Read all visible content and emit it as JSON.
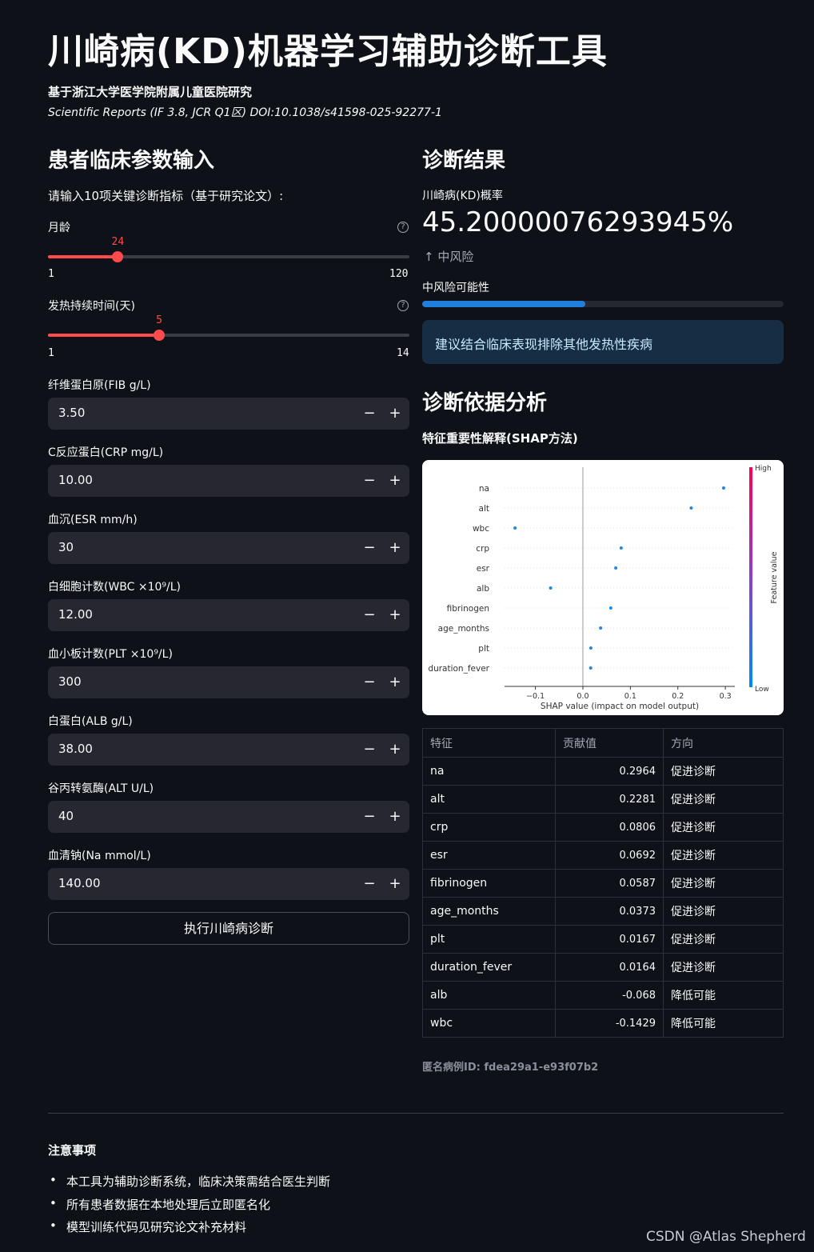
{
  "header": {
    "title": "川崎病(KD)机器学习辅助诊断工具",
    "subtitle": "基于浙江大学医学院附属儿童医院研究",
    "citation": "Scientific Reports (IF 3.8, JCR Q1区) DOI:10.1038/s41598-025-92277-1"
  },
  "input_section": {
    "heading": "患者临床参数输入",
    "instruction": "请输入10项关键诊断指标（基于研究论文）:",
    "sliders": [
      {
        "label": "月龄",
        "value": "24",
        "min": "1",
        "max": "120",
        "fraction": 0.1933
      },
      {
        "label": "发热持续时间(天)",
        "value": "5",
        "min": "1",
        "max": "14",
        "fraction": 0.3077
      }
    ],
    "number_inputs": [
      {
        "label": "纤维蛋白原(FIB g/L)",
        "value": "3.50"
      },
      {
        "label": "C反应蛋白(CRP mg/L)",
        "value": "10.00"
      },
      {
        "label": "血沉(ESR mm/h)",
        "value": "30"
      },
      {
        "label": "白细胞计数(WBC ×10⁹/L)",
        "value": "12.00"
      },
      {
        "label": "血小板计数(PLT ×10⁹/L)",
        "value": "300"
      },
      {
        "label": "白蛋白(ALB g/L)",
        "value": "38.00"
      },
      {
        "label": "谷丙转氨酶(ALT U/L)",
        "value": "40"
      },
      {
        "label": "血清钠(Na mmol/L)",
        "value": "140.00"
      }
    ],
    "minus_glyph": "−",
    "plus_glyph": "+",
    "help_glyph": "?",
    "submit_label": "执行川崎病诊断"
  },
  "result_section": {
    "heading": "诊断结果",
    "metric_label": "川崎病(KD)概率",
    "metric_value": "45.20000076293945%",
    "delta_arrow": "↑",
    "delta_text": "中风险",
    "progress_label": "中风险可能性",
    "progress_fraction": 0.452,
    "info_text": "建议结合临床表现排除其他发热性疾病",
    "progress_color": "#1f7fdb"
  },
  "analysis_section": {
    "heading": "诊断依据分析",
    "subheading": "特征重要性解释(SHAP方法)"
  },
  "chart_data": {
    "type": "scatter",
    "categories": [
      "na",
      "alt",
      "wbc",
      "crp",
      "esr",
      "alb",
      "fibrinogen",
      "age_months",
      "plt",
      "duration_fever"
    ],
    "values": [
      0.2964,
      0.2281,
      -0.1429,
      0.0806,
      0.0692,
      -0.068,
      0.0587,
      0.0373,
      0.0167,
      0.0164
    ],
    "xlabel": "SHAP value (impact on model output)",
    "xticks": [
      "−0.1",
      "0.0",
      "0.1",
      "0.2",
      "0.3"
    ],
    "xtick_values": [
      -0.1,
      0.0,
      0.1,
      0.2,
      0.3
    ],
    "xlim": [
      -0.165,
      0.32
    ],
    "colorbar_label": "Feature value",
    "colorbar_high": "High",
    "colorbar_low": "Low",
    "point_color": "#1e88e5"
  },
  "shap_table": {
    "headers": [
      "特征",
      "贡献值",
      "方向"
    ],
    "rows": [
      [
        "na",
        "0.2964",
        "促进诊断"
      ],
      [
        "alt",
        "0.2281",
        "促进诊断"
      ],
      [
        "crp",
        "0.0806",
        "促进诊断"
      ],
      [
        "esr",
        "0.0692",
        "促进诊断"
      ],
      [
        "fibrinogen",
        "0.0587",
        "促进诊断"
      ],
      [
        "age_months",
        "0.0373",
        "促进诊断"
      ],
      [
        "plt",
        "0.0167",
        "促进诊断"
      ],
      [
        "duration_fever",
        "0.0164",
        "促进诊断"
      ],
      [
        "alb",
        "-0.068",
        "降低可能"
      ],
      [
        "wbc",
        "-0.1429",
        "降低可能"
      ]
    ]
  },
  "anon_id": "匿名病例ID: fdea29a1-e93f07b2",
  "notes": {
    "title": "注意事项",
    "items": [
      "本工具为辅助诊断系统，临床决策需结合医生判断",
      "所有患者数据在本地处理后立即匿名化",
      "模型训练代码见研究论文补充材料"
    ]
  },
  "watermark": "CSDN @Atlas Shepherd"
}
